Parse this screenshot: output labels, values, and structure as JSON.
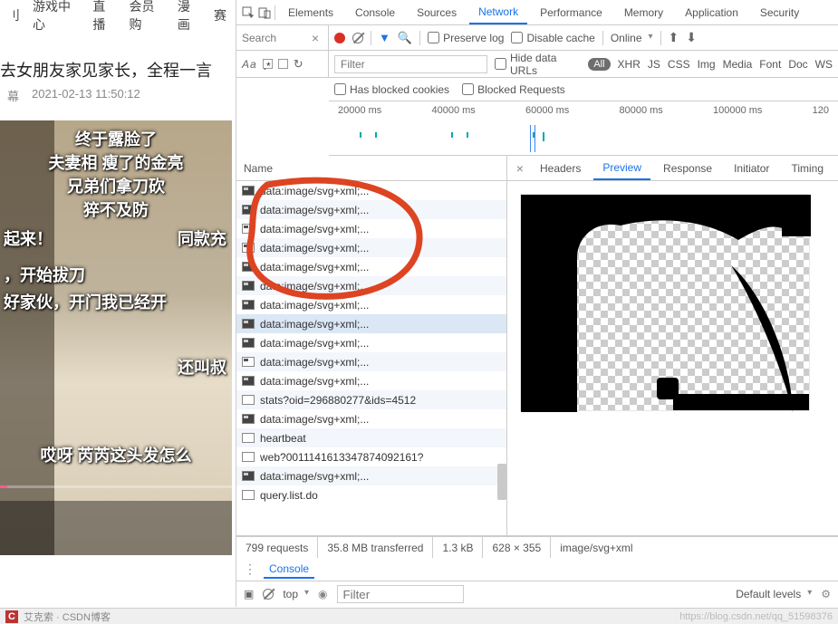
{
  "webpage": {
    "nav": [
      "刂",
      "游戏中心",
      "直播",
      "会员购",
      "漫画",
      "赛"
    ],
    "title": "去女朋友家见家长，全程一言",
    "meta_badge": "幕",
    "meta_time": "2021-02-13 11:50:12",
    "overlay": {
      "l1": "终于露脸了",
      "l2": "夫妻相  瘦了的金亮",
      "l3": "兄弟们拿刀砍",
      "l4": "猝不及防",
      "l5a": "起来！",
      "l5b": "同款充",
      "l6": "，开始拔刀",
      "l7": "好家伙，开门我已经开",
      "l8": "还叫叔",
      "l9": "哎呀 芮芮这头发怎么"
    }
  },
  "devtools": {
    "tabs": [
      "Elements",
      "Console",
      "Sources",
      "Network",
      "Performance",
      "Memory",
      "Application",
      "Security"
    ],
    "active_tab": "Network",
    "search_label": "Search",
    "preserve_log": "Preserve log",
    "disable_cache": "Disable cache",
    "throttling": "Online",
    "filter_placeholder": "Filter",
    "hide_data_urls": "Hide data URLs",
    "type_filters": [
      "All",
      "XHR",
      "JS",
      "CSS",
      "Img",
      "Media",
      "Font",
      "Doc",
      "WS"
    ],
    "blocked_cookies": "Has blocked cookies",
    "blocked_requests": "Blocked Requests",
    "timeline_ticks": [
      "20000 ms",
      "40000 ms",
      "60000 ms",
      "80000 ms",
      "100000 ms",
      "120"
    ],
    "name_header": "Name",
    "requests": [
      {
        "t": "data:image/svg+xml;...",
        "i": "dark"
      },
      {
        "t": "data:image/svg+xml;...",
        "i": "dark"
      },
      {
        "t": "data:image/svg+xml;...",
        "i": ""
      },
      {
        "t": "data:image/svg+xml;...",
        "i": ""
      },
      {
        "t": "data:image/svg+xml;...",
        "i": "dark"
      },
      {
        "t": "data:image/svg+xml;...",
        "i": "dark"
      },
      {
        "t": "data:image/svg+xml;...",
        "i": "dark"
      },
      {
        "t": "data:image/svg+xml;...",
        "i": "dark",
        "sel": true
      },
      {
        "t": "data:image/svg+xml;...",
        "i": "dark"
      },
      {
        "t": "data:image/svg+xml;...",
        "i": ""
      },
      {
        "t": "data:image/svg+xml;...",
        "i": "dark"
      },
      {
        "t": "stats?oid=296880277&ids=4512",
        "i": "blank"
      },
      {
        "t": "data:image/svg+xml;...",
        "i": "dark"
      },
      {
        "t": "heartbeat",
        "i": "blank"
      },
      {
        "t": "web?0011141613347874092161?",
        "i": "blank"
      },
      {
        "t": "data:image/svg+xml;...",
        "i": "dark"
      },
      {
        "t": "query.list.do",
        "i": "blank"
      }
    ],
    "detail_tabs": [
      "Headers",
      "Preview",
      "Response",
      "Initiator",
      "Timing"
    ],
    "active_detail_tab": "Preview",
    "status": {
      "requests": "799 requests",
      "transferred": "35.8 MB transferred",
      "size": "1.3 kB",
      "dims": "628 × 355",
      "mime": "image/svg+xml"
    },
    "console": {
      "label": "Console",
      "context": "top",
      "filter_placeholder": "Filter",
      "levels": "Default levels"
    }
  },
  "bottom": {
    "text": "艾克索 · CSDN博客",
    "watermark": "https://blog.csdn.net/qq_51598376"
  }
}
